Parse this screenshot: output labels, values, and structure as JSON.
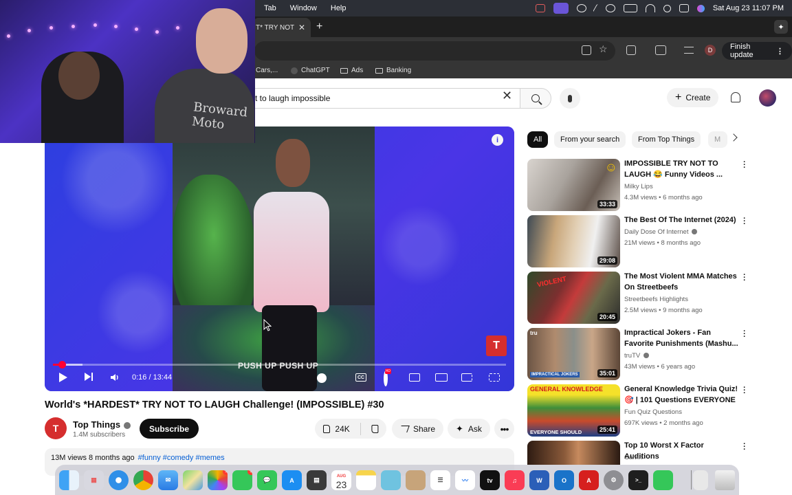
{
  "menubar": {
    "menus": [
      "Tab",
      "Window",
      "Help"
    ],
    "datetime": "Sat Aug 23  11:07 PM"
  },
  "chrome": {
    "tab_title": "T* TRY NOT",
    "finish_update": "Finish update",
    "profile_initial": "D",
    "bookmarks": [
      "Cars,...",
      "ChatGPT",
      "Ads",
      "Banking"
    ]
  },
  "youtube": {
    "search_value": "t to laugh impossible",
    "create_label": "Create",
    "player": {
      "time": "0:16 / 13:44",
      "caption": "PUSH UP PUSH UP",
      "progress_fraction": 0.0194,
      "buffered_fraction": 0.065
    },
    "video": {
      "title": "World's *HARDEST* TRY NOT TO LAUGH Challenge! (IMPOSSIBLE) #30",
      "channel": "Top Things",
      "subscribers": "1.4M subscribers",
      "subscribe_label": "Subscribe",
      "likes": "24K",
      "share_label": "Share",
      "ask_label": "Ask",
      "views_date": "13M views  8 months ago",
      "hashtags": "#funny #comedy #memes"
    },
    "chips": [
      "All",
      "From your search",
      "From Top Things",
      "M"
    ],
    "recommendations": [
      {
        "title": "IMPOSSIBLE TRY NOT TO LAUGH 😂 Funny Videos ...",
        "channel": "Milky Lips",
        "meta": "4.3M views • 6 months ago",
        "duration": "33:33",
        "verified": false
      },
      {
        "title": "The Best Of The Internet (2024)",
        "channel": "Daily Dose Of Internet",
        "meta": "21M views • 8 months ago",
        "duration": "29:08",
        "verified": true
      },
      {
        "title": "The Most Violent MMA Matches On Streetbeefs",
        "channel": "Streetbeefs Highlights",
        "meta": "2.5M views • 9 months ago",
        "duration": "20:45",
        "verified": false
      },
      {
        "title": "Impractical Jokers - Fan Favorite Punishments (Mashu...",
        "channel": "truTV",
        "meta": "43M views • 6 years ago",
        "duration": "35:01",
        "verified": true
      },
      {
        "title": "General Knowledge Trivia Quiz! 🎯 | 101 Questions EVERYONE ...",
        "channel": "Fun Quiz Questions",
        "meta": "697K views • 2 months ago",
        "duration": "25:41",
        "verified": false
      },
      {
        "title": "Top 10 Worst X Factor Auditions",
        "channel": "Calvin",
        "meta": "",
        "duration": "",
        "verified": false
      }
    ]
  },
  "webcam": {
    "hoodie_text": "Broward Moto"
  },
  "dock": {
    "calendar_month": "AUG",
    "calendar_day": "23",
    "messages_badge": "1",
    "facetime_badge": "1"
  }
}
